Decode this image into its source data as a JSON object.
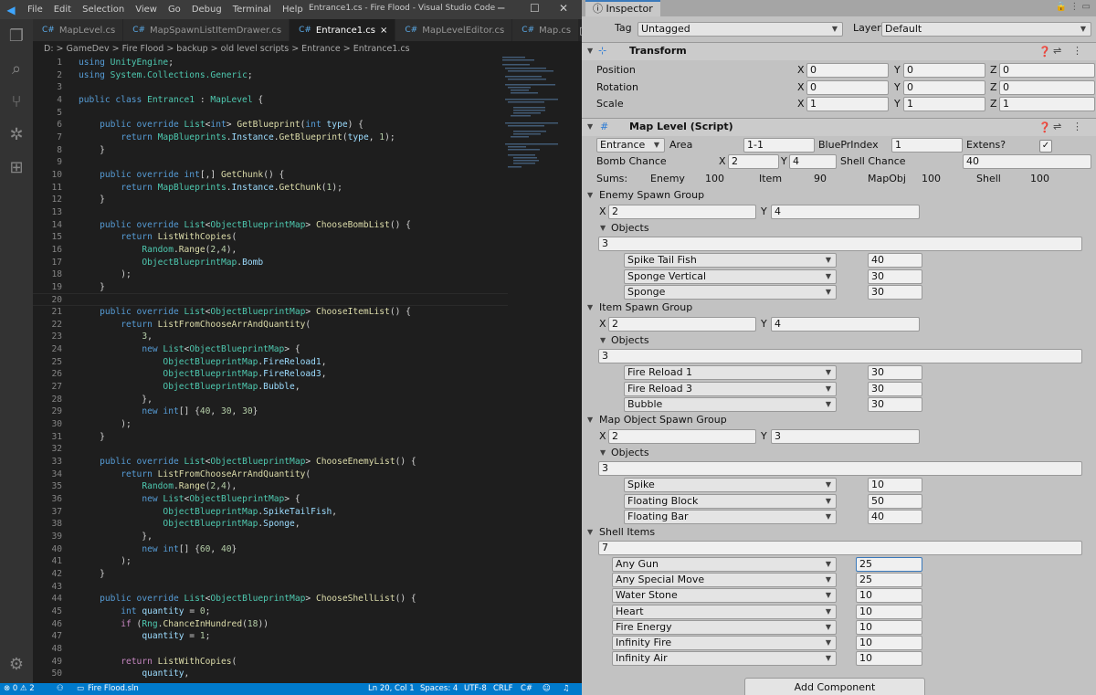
{
  "vscode": {
    "menu": [
      "File",
      "Edit",
      "Selection",
      "View",
      "Go",
      "Debug",
      "Terminal",
      "Help"
    ],
    "window_title": "Entrance1.cs - Fire Flood - Visual Studio Code",
    "tabs": [
      {
        "label": "MapLevel.cs"
      },
      {
        "label": "MapSpawnListItemDrawer.cs"
      },
      {
        "label": "Entrance1.cs",
        "active": true
      },
      {
        "label": "MapLevelEditor.cs"
      },
      {
        "label": "Map.cs"
      }
    ],
    "breadcrumb": "D: > GameDev > Fire Flood > backup > old level scripts > Entrance > Entrance1.cs",
    "lines": [
      [
        "1",
        "<span class='k'>using</span> <span class='t'>UnityEngine</span>;"
      ],
      [
        "2",
        "<span class='k'>using</span> <span class='t'>System.Collections.Generic</span>;"
      ],
      [
        "3",
        ""
      ],
      [
        "4",
        "<span class='k'>public class</span> <span class='t'>Entrance1</span> : <span class='t'>MapLevel</span> {"
      ],
      [
        "5",
        ""
      ],
      [
        "6",
        "    <span class='k'>public override</span> <span class='t'>List</span>&lt;<span class='k'>int</span>&gt; <span class='f'>GetBlueprint</span>(<span class='k'>int</span> <span class='p'>type</span>) {"
      ],
      [
        "7",
        "        <span class='k'>return</span> <span class='t'>MapBlueprints</span>.<span class='p'>Instance</span>.<span class='f'>GetBlueprint</span>(<span class='p'>type</span>, <span class='n'>1</span>);"
      ],
      [
        "8",
        "    }"
      ],
      [
        "9",
        ""
      ],
      [
        "10",
        "    <span class='k'>public override int</span>[,] <span class='f'>GetChunk</span>() {"
      ],
      [
        "11",
        "        <span class='k'>return</span> <span class='t'>MapBlueprints</span>.<span class='p'>Instance</span>.<span class='f'>GetChunk</span>(<span class='n'>1</span>);"
      ],
      [
        "12",
        "    }"
      ],
      [
        "13",
        ""
      ],
      [
        "14",
        "    <span class='k'>public override</span> <span class='t'>List</span>&lt;<span class='t'>ObjectBlueprintMap</span>&gt; <span class='f'>ChooseBombList</span>() {"
      ],
      [
        "15",
        "        <span class='k'>return</span> <span class='f'>ListWithCopies</span>("
      ],
      [
        "16",
        "            <span class='t'>Random</span>.<span class='f'>Range</span>(<span class='n'>2</span>,<span class='n'>4</span>),"
      ],
      [
        "17",
        "            <span class='t'>ObjectBlueprintMap</span>.<span class='p'>Bomb</span>"
      ],
      [
        "18",
        "        );"
      ],
      [
        "19",
        "    }"
      ],
      [
        "20",
        ""
      ],
      [
        "21",
        "    <span class='k'>public override</span> <span class='t'>List</span>&lt;<span class='t'>ObjectBlueprintMap</span>&gt; <span class='f'>ChooseItemList</span>() {"
      ],
      [
        "22",
        "        <span class='k'>return</span> <span class='f'>ListFromChooseArrAndQuantity</span>("
      ],
      [
        "23",
        "            <span class='n'>3</span>,"
      ],
      [
        "24",
        "            <span class='k'>new</span> <span class='t'>List</span>&lt;<span class='t'>ObjectBlueprintMap</span>&gt; {"
      ],
      [
        "25",
        "                <span class='t'>ObjectBlueprintMap</span>.<span class='p'>FireReload1</span>,"
      ],
      [
        "26",
        "                <span class='t'>ObjectBlueprintMap</span>.<span class='p'>FireReload3</span>,"
      ],
      [
        "27",
        "                <span class='t'>ObjectBlueprintMap</span>.<span class='p'>Bubble</span>,"
      ],
      [
        "28",
        "            },"
      ],
      [
        "29",
        "            <span class='k'>new int</span>[] {<span class='n'>40</span>, <span class='n'>30</span>, <span class='n'>30</span>}"
      ],
      [
        "30",
        "        );"
      ],
      [
        "31",
        "    }"
      ],
      [
        "32",
        ""
      ],
      [
        "33",
        "    <span class='k'>public override</span> <span class='t'>List</span>&lt;<span class='t'>ObjectBlueprintMap</span>&gt; <span class='f'>ChooseEnemyList</span>() {"
      ],
      [
        "34",
        "        <span class='k'>return</span> <span class='f'>ListFromChooseArrAndQuantity</span>("
      ],
      [
        "35",
        "            <span class='t'>Random</span>.<span class='f'>Range</span>(<span class='n'>2</span>,<span class='n'>4</span>),"
      ],
      [
        "36",
        "            <span class='k'>new</span> <span class='t'>List</span>&lt;<span class='t'>ObjectBlueprintMap</span>&gt; {"
      ],
      [
        "37",
        "                <span class='t'>ObjectBlueprintMap</span>.<span class='p'>SpikeTailFish</span>,"
      ],
      [
        "38",
        "                <span class='t'>ObjectBlueprintMap</span>.<span class='p'>Sponge</span>,"
      ],
      [
        "39",
        "            },"
      ],
      [
        "40",
        "            <span class='k'>new int</span>[] {<span class='n'>60</span>, <span class='n'>40</span>}"
      ],
      [
        "41",
        "        );"
      ],
      [
        "42",
        "    }"
      ],
      [
        "43",
        ""
      ],
      [
        "44",
        "    <span class='k'>public override</span> <span class='t'>List</span>&lt;<span class='t'>ObjectBlueprintMap</span>&gt; <span class='f'>ChooseShellList</span>() {"
      ],
      [
        "45",
        "        <span class='k'>int</span> <span class='p'>quantity</span> = <span class='n'>0</span>;"
      ],
      [
        "46",
        "        <span class='c'>if</span> (<span class='t'>Rng</span>.<span class='f'>ChanceInHundred</span>(<span class='n'>18</span>))"
      ],
      [
        "47",
        "            <span class='p'>quantity</span> = <span class='n'>1</span>;"
      ],
      [
        "48",
        ""
      ],
      [
        "49",
        "        <span class='c'>return</span> <span class='f'>ListWithCopies</span>("
      ],
      [
        "50",
        "            <span class='p'>quantity</span>,"
      ]
    ],
    "status": {
      "problems": "⊗ 0 ⚠ 2",
      "solution": "Fire Flood.sln",
      "position": "Ln 20, Col 1",
      "spaces": "Spaces: 4",
      "encoding": "UTF-8",
      "eol": "CRLF",
      "lang": "C#"
    }
  },
  "inspector": {
    "tab": "Inspector",
    "tag_label": "Tag",
    "tag_value": "Untagged",
    "layer_label": "Layer",
    "layer_value": "Default",
    "transform": {
      "title": "Transform",
      "position_label": "Position",
      "rotation_label": "Rotation",
      "scale_label": "Scale",
      "pos": [
        "0",
        "0",
        "0"
      ],
      "rot": [
        "0",
        "0",
        "0"
      ],
      "scale": [
        "1",
        "1",
        "1"
      ]
    },
    "maplevel": {
      "title": "Map Level (Script)",
      "type_value": "Entrance",
      "area_label": "Area",
      "area_value": "1-1",
      "bp_label": "BluePrIndex",
      "bp_value": "1",
      "extens_label": "Extens?",
      "bomb_label": "Bomb Chance",
      "bomb_x": "2",
      "bomb_y": "4",
      "shell_chance_label": "Shell Chance",
      "shell_chance_value": "40",
      "sums_label": "Sums:",
      "enemy_label": "Enemy",
      "enemy_sum": "100",
      "item_label": "Item",
      "item_sum": "90",
      "mapobj_label": "MapObj",
      "mapobj_sum": "100",
      "shell_label": "Shell",
      "shell_sum": "100"
    },
    "enemy_group": {
      "title": "Enemy Spawn Group",
      "x": "2",
      "y": "4",
      "objects_label": "Objects",
      "count": "3",
      "items": [
        {
          "name": "Spike Tail Fish",
          "value": "40"
        },
        {
          "name": "Sponge Vertical",
          "value": "30"
        },
        {
          "name": "Sponge",
          "value": "30"
        }
      ]
    },
    "item_group": {
      "title": "Item Spawn Group",
      "x": "2",
      "y": "4",
      "objects_label": "Objects",
      "count": "3",
      "items": [
        {
          "name": "Fire Reload 1",
          "value": "30"
        },
        {
          "name": "Fire Reload 3",
          "value": "30"
        },
        {
          "name": "Bubble",
          "value": "30"
        }
      ]
    },
    "mapobj_group": {
      "title": "Map Object Spawn Group",
      "x": "2",
      "y": "3",
      "objects_label": "Objects",
      "count": "3",
      "items": [
        {
          "name": "Spike",
          "value": "10"
        },
        {
          "name": "Floating Block",
          "value": "50"
        },
        {
          "name": "Floating Bar",
          "value": "40"
        }
      ]
    },
    "shell_items": {
      "title": "Shell Items",
      "count": "7",
      "items": [
        {
          "name": "Any Gun",
          "value": "25"
        },
        {
          "name": "Any Special Move",
          "value": "25"
        },
        {
          "name": "Water Stone",
          "value": "10"
        },
        {
          "name": "Heart",
          "value": "10"
        },
        {
          "name": "Fire Energy",
          "value": "10"
        },
        {
          "name": "Infinity Fire",
          "value": "10"
        },
        {
          "name": "Infinity Air",
          "value": "10"
        }
      ]
    },
    "add_component": "Add Component",
    "x_label": "X",
    "y_label": "Y",
    "z_label": "Z"
  }
}
